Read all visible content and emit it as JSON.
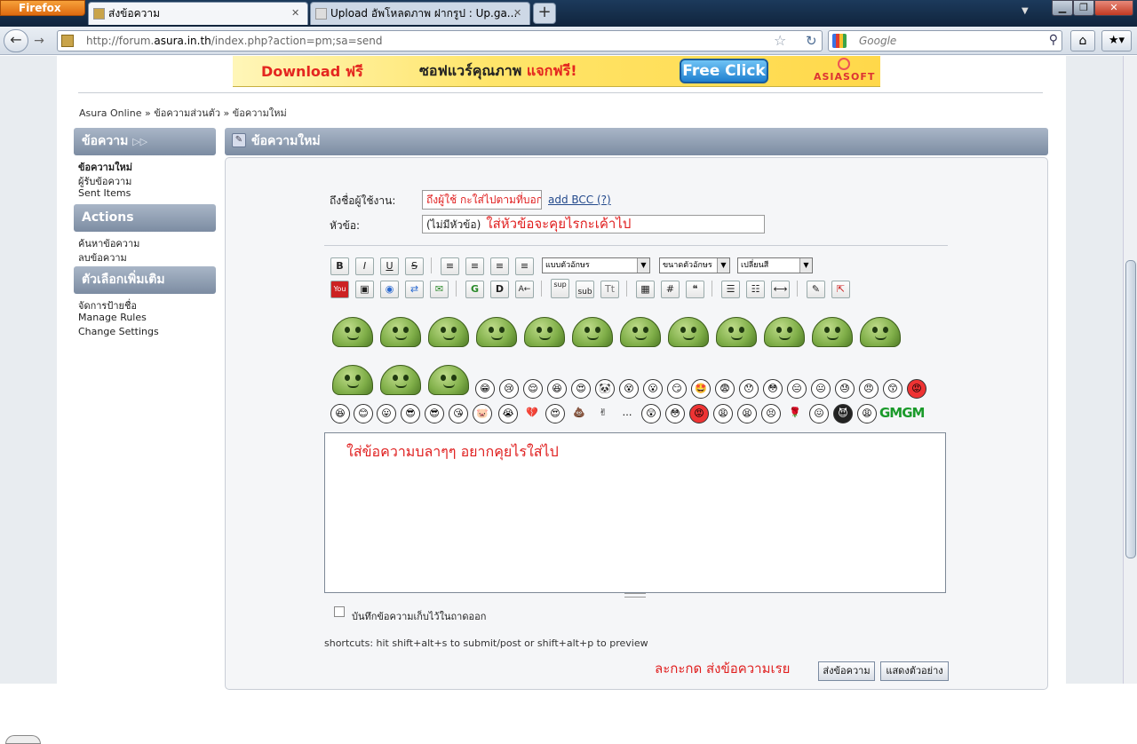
{
  "browser": {
    "app_button": "Firefox",
    "tabs": [
      {
        "label": "ส่งข้อความ"
      },
      {
        "label": "Upload อัพโหลดภาพ ฝากรูป : Up.ga..."
      }
    ],
    "new_tab": "+",
    "url_prefix": "http://forum.",
    "url_host": "asura.in.th",
    "url_path": "/index.php?action=pm;sa=send",
    "search_engine": "Google",
    "window_controls": {
      "minimize": "▁",
      "maximize": "❐",
      "close": "✕"
    }
  },
  "banner": {
    "download": "Download ฟรี",
    "middle": "ซอฟแวร์คุณภาพ",
    "middle_red": "แจกฟรี!",
    "button": "Free Click",
    "logo": "ASIASOFT"
  },
  "breadcrumb": {
    "items": [
      "Asura Online",
      "ข้อความส่วนตัว",
      "ข้อความใหม่"
    ],
    "separator": "»"
  },
  "sidebar": {
    "sections": [
      {
        "title": "ข้อความ",
        "links": [
          "ข้อความใหม่",
          "ผู้รับข้อความ",
          "Sent Items"
        ]
      },
      {
        "title": "Actions",
        "links": [
          "ค้นหาข้อความ",
          "ลบข้อความ"
        ]
      },
      {
        "title": "ตัวเลือกเพิ่มเติม",
        "links": [
          "จัดการป้ายชื่อ",
          "Manage Rules",
          "Change Settings"
        ]
      }
    ]
  },
  "panel": {
    "title": "ข้อความใหม่"
  },
  "form": {
    "to_label": "ถึงชื่อผู้ใช้งาน:",
    "to_value": "ถึงผู้ใช้ กะใส่ไปตามที่บอกเลย",
    "add_bcc": "add BCC (?)",
    "subject_label": "หัวข้อ:",
    "subject_value": "(ไม่มีหัวข้อ)",
    "subject_note": "ใส่หัวข้อจะคุยไรกะเค้าไป",
    "font_select": "แบบตัวอักษร",
    "size_select": "ขนาดตัวอักษร",
    "color_select": "เปลี่ยนสี",
    "message": "ใส่ข้อความบลาๆๆ อยากคุยไรใส่ไป",
    "save_copy_label": "บันทึกข้อความเก็บไว้ในถาดออก",
    "shortcuts": "shortcuts: hit shift+alt+s to submit/post or shift+alt+p to preview",
    "cta": "ละกะกด ส่งข้อความเรย",
    "send_button": "ส่งข้อความ",
    "preview_button": "แสดงตัวอย่าง"
  },
  "toolbar": {
    "row1": [
      "B",
      "I",
      "U",
      "S"
    ],
    "row2": [
      "You",
      "▣",
      "◉",
      "⇄",
      "✉",
      "G",
      "D",
      "A←",
      "sup",
      "sub",
      "Tt",
      "▦",
      "#",
      "❝",
      "☰",
      "☷",
      "⟷",
      "✎",
      "⇱"
    ]
  },
  "emoticons": {
    "row3": [
      "😁",
      "😢",
      "😌",
      "😆",
      "😍",
      "🐼",
      "😵",
      "😮",
      "😏",
      "🤩",
      "😨",
      "😯",
      "😳",
      "😑",
      "😐",
      "😓",
      "😠",
      "😙",
      "😡"
    ],
    "row4": [
      "😆",
      "😊",
      "😛",
      "😎",
      "😎",
      "😘",
      "🐷",
      "😭",
      "💔",
      "😍",
      "💩",
      "✌",
      "…",
      "😲",
      "😳",
      "😡",
      "😩",
      "😫",
      "😣",
      "🌹",
      "😖",
      "😈",
      "😩"
    ],
    "row4_tail": "GMGM"
  }
}
